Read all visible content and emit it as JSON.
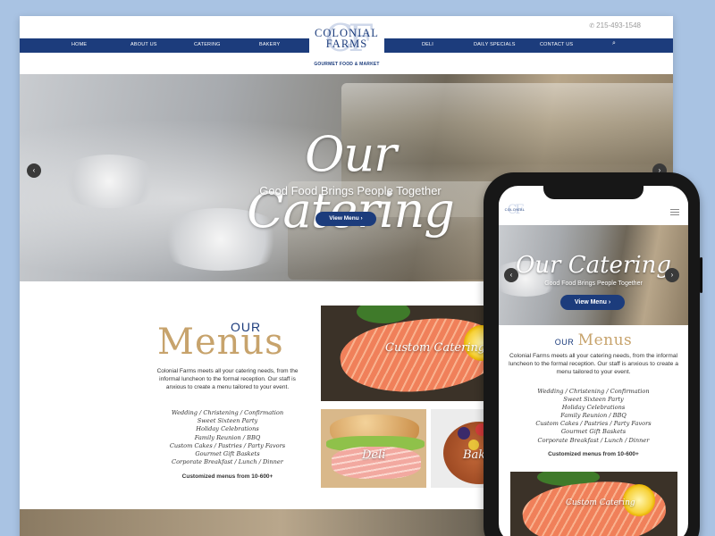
{
  "site": {
    "phone": "215-493-1548",
    "logo": {
      "monogram": "CF",
      "name_line1": "COLONIAL",
      "name_line2": "FARMS",
      "tagline": "GOURMET FOOD & MARKET"
    },
    "nav": [
      {
        "label": "HOME"
      },
      {
        "label": "ABOUT US"
      },
      {
        "label": "CATERING"
      },
      {
        "label": "BAKERY"
      },
      {
        "label": "DELI"
      },
      {
        "label": "DAILY SPECIALS"
      },
      {
        "label": "CONTACT US"
      }
    ],
    "search_icon": "search-icon"
  },
  "hero": {
    "title": "Our Catering",
    "subtitle": "Good Food Brings People Together",
    "button": "View Menu ›",
    "prev": "‹",
    "next": "›"
  },
  "menus": {
    "our": "OUR",
    "title": "Menus",
    "description": "Colonial Farms meets all your catering needs, from the informal luncheon to the formal reception. Our staff is anxious to create a menu tailored to your event.",
    "items": [
      "Wedding / Christening / Confirmation",
      "Sweet Sixteen Party",
      "Holiday Celebrations",
      "Family Reunion / BBQ",
      "Custom Cakes / Pastries / Party Favors",
      "Gourmet Gift Baskets",
      "Corporate Breakfast / Lunch / Dinner"
    ],
    "footnote": "Customized menus from 10-600+"
  },
  "tiles": {
    "catering": "Custom Catering",
    "deli": "Deli",
    "bakery": "Bak"
  },
  "colors": {
    "navy": "#1c3c7c",
    "gold": "#c7a36c",
    "background": "#a9c3e3"
  }
}
